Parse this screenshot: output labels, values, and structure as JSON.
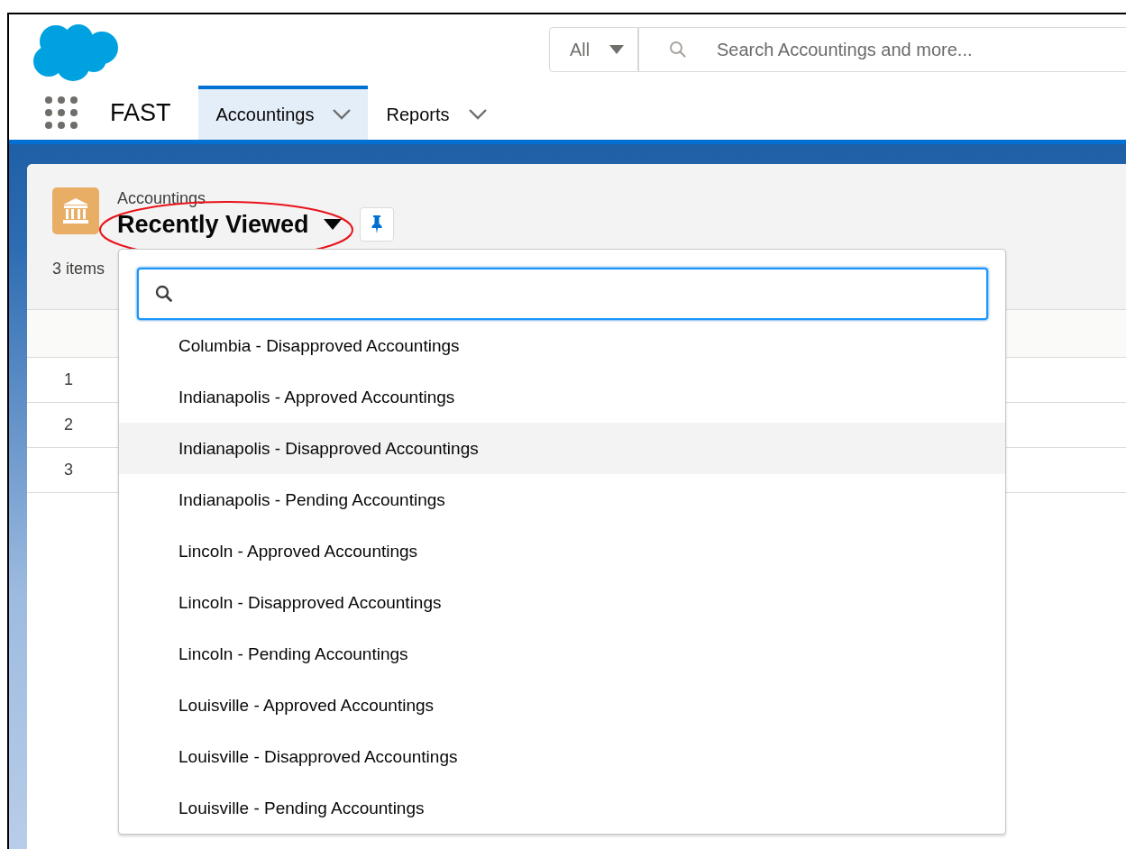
{
  "app": {
    "name": "FAST"
  },
  "search": {
    "scope": "All",
    "placeholder": "Search Accountings and more..."
  },
  "nav_tabs": [
    {
      "label": "Accountings",
      "selected": true
    },
    {
      "label": "Reports",
      "selected": false
    }
  ],
  "list_view": {
    "object": "Accountings",
    "title": "Recently Viewed",
    "count": "3 items",
    "row_numbers": [
      "1",
      "2",
      "3"
    ]
  },
  "dropdown": {
    "items": [
      {
        "label": "Columbia - Disapproved Accountings",
        "highlighted": false
      },
      {
        "label": "Indianapolis - Approved Accountings",
        "highlighted": false
      },
      {
        "label": "Indianapolis - Disapproved Accountings",
        "highlighted": true
      },
      {
        "label": "Indianapolis - Pending Accountings",
        "highlighted": false
      },
      {
        "label": "Lincoln - Approved Accountings",
        "highlighted": false
      },
      {
        "label": "Lincoln - Disapproved Accountings",
        "highlighted": false
      },
      {
        "label": "Lincoln - Pending Accountings",
        "highlighted": false
      },
      {
        "label": "Louisville - Approved Accountings",
        "highlighted": false
      },
      {
        "label": "Louisville - Disapproved Accountings",
        "highlighted": false
      },
      {
        "label": "Louisville - Pending Accountings",
        "highlighted": false
      }
    ]
  },
  "annotation": {
    "kind": "ellipse"
  }
}
